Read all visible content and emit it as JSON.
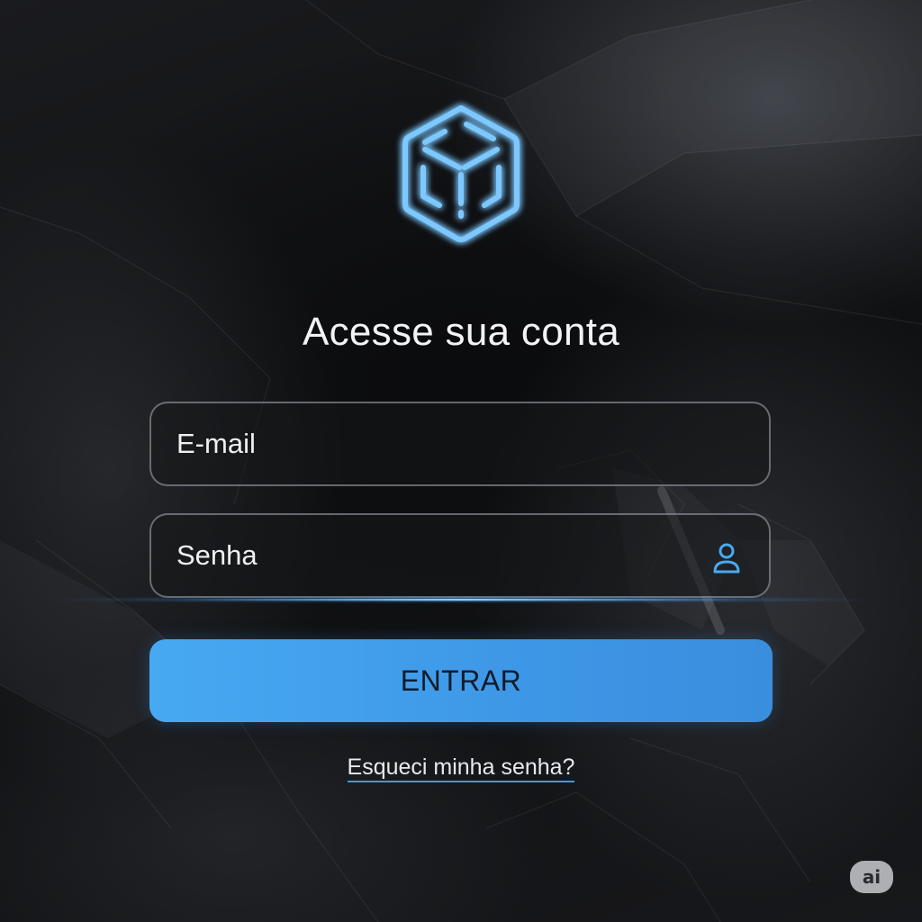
{
  "page": {
    "title": "Acesse sua conta"
  },
  "logo": {
    "icon": "cube-icon",
    "color": "#4fb4ff"
  },
  "form": {
    "email_placeholder": "E-mail",
    "password_placeholder": "Senha",
    "password_icon": "user-icon",
    "submit_label": "ENTRAR",
    "forgot_label": "Esqueci minha senha?"
  },
  "badge": {
    "label": "ai"
  },
  "colors": {
    "accent": "#42a2ee",
    "background": "#0f1012",
    "text": "#f2f3f5"
  }
}
